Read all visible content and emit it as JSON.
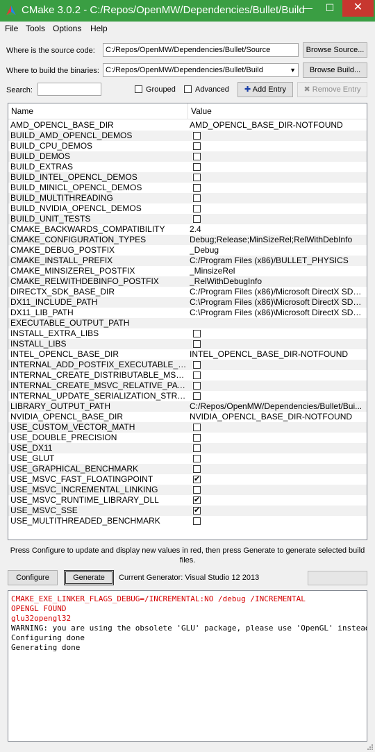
{
  "window": {
    "title": "CMake 3.0.2 - C:/Repos/OpenMW/Dependencies/Bullet/Build",
    "minimize_glyph": "—",
    "maximize_glyph": "☐",
    "close_glyph": "✕"
  },
  "menu": [
    "File",
    "Tools",
    "Options",
    "Help"
  ],
  "source": {
    "label": "Where is the source code:",
    "value": "C:/Repos/OpenMW/Dependencies/Bullet/Source",
    "button": "Browse Source..."
  },
  "build": {
    "label": "Where to build the binaries:",
    "value": "C:/Repos/OpenMW/Dependencies/Bullet/Build",
    "button": "Browse Build..."
  },
  "search": {
    "label": "Search:",
    "value": ""
  },
  "options": {
    "grouped": {
      "label": "Grouped",
      "checked": false
    },
    "advanced": {
      "label": "Advanced",
      "checked": false
    },
    "add_entry": "Add Entry",
    "remove_entry": "Remove Entry"
  },
  "table": {
    "headers": [
      "Name",
      "Value"
    ],
    "rows": [
      {
        "name": "AMD_OPENCL_BASE_DIR",
        "type": "text",
        "value": "AMD_OPENCL_BASE_DIR-NOTFOUND"
      },
      {
        "name": "BUILD_AMD_OPENCL_DEMOS",
        "type": "bool",
        "checked": false
      },
      {
        "name": "BUILD_CPU_DEMOS",
        "type": "bool",
        "checked": false
      },
      {
        "name": "BUILD_DEMOS",
        "type": "bool",
        "checked": false
      },
      {
        "name": "BUILD_EXTRAS",
        "type": "bool",
        "checked": false
      },
      {
        "name": "BUILD_INTEL_OPENCL_DEMOS",
        "type": "bool",
        "checked": false
      },
      {
        "name": "BUILD_MINICL_OPENCL_DEMOS",
        "type": "bool",
        "checked": false
      },
      {
        "name": "BUILD_MULTITHREADING",
        "type": "bool",
        "checked": false
      },
      {
        "name": "BUILD_NVIDIA_OPENCL_DEMOS",
        "type": "bool",
        "checked": false
      },
      {
        "name": "BUILD_UNIT_TESTS",
        "type": "bool",
        "checked": false
      },
      {
        "name": "CMAKE_BACKWARDS_COMPATIBILITY",
        "type": "text",
        "value": "2.4"
      },
      {
        "name": "CMAKE_CONFIGURATION_TYPES",
        "type": "text",
        "value": "Debug;Release;MinSizeRel;RelWithDebInfo"
      },
      {
        "name": "CMAKE_DEBUG_POSTFIX",
        "type": "text",
        "value": "_Debug"
      },
      {
        "name": "CMAKE_INSTALL_PREFIX",
        "type": "text",
        "value": "C:/Program Files (x86)/BULLET_PHYSICS"
      },
      {
        "name": "CMAKE_MINSIZEREL_POSTFIX",
        "type": "text",
        "value": "_MinsizeRel"
      },
      {
        "name": "CMAKE_RELWITHDEBINFO_POSTFIX",
        "type": "text",
        "value": "_RelWithDebugInfo"
      },
      {
        "name": "DIRECTX_SDK_BASE_DIR",
        "type": "text",
        "value": "C:/Program Files (x86)/Microsoft DirectX SDK ..."
      },
      {
        "name": "DX11_INCLUDE_PATH",
        "type": "text",
        "value": "C:\\Program Files (x86)\\Microsoft DirectX SDK ..."
      },
      {
        "name": "DX11_LIB_PATH",
        "type": "text",
        "value": "C:\\Program Files (x86)\\Microsoft DirectX SDK ..."
      },
      {
        "name": "EXECUTABLE_OUTPUT_PATH",
        "type": "text",
        "value": ""
      },
      {
        "name": "INSTALL_EXTRA_LIBS",
        "type": "bool",
        "checked": false
      },
      {
        "name": "INSTALL_LIBS",
        "type": "bool",
        "checked": false
      },
      {
        "name": "INTEL_OPENCL_BASE_DIR",
        "type": "text",
        "value": "INTEL_OPENCL_BASE_DIR-NOTFOUND"
      },
      {
        "name": "INTERNAL_ADD_POSTFIX_EXECUTABLE_NAMES",
        "type": "bool",
        "checked": false
      },
      {
        "name": "INTERNAL_CREATE_DISTRIBUTABLE_MSVC_P...",
        "type": "bool",
        "checked": false
      },
      {
        "name": "INTERNAL_CREATE_MSVC_RELATIVE_PATH_P...",
        "type": "bool",
        "checked": false
      },
      {
        "name": "INTERNAL_UPDATE_SERIALIZATION_STRUCT...",
        "type": "bool",
        "checked": false
      },
      {
        "name": "LIBRARY_OUTPUT_PATH",
        "type": "text",
        "value": "C:/Repos/OpenMW/Dependencies/Bullet/Bui..."
      },
      {
        "name": "NVIDIA_OPENCL_BASE_DIR",
        "type": "text",
        "value": "NVIDIA_OPENCL_BASE_DIR-NOTFOUND"
      },
      {
        "name": "USE_CUSTOM_VECTOR_MATH",
        "type": "bool",
        "checked": false
      },
      {
        "name": "USE_DOUBLE_PRECISION",
        "type": "bool",
        "checked": false
      },
      {
        "name": "USE_DX11",
        "type": "bool",
        "checked": false
      },
      {
        "name": "USE_GLUT",
        "type": "bool",
        "checked": false
      },
      {
        "name": "USE_GRAPHICAL_BENCHMARK",
        "type": "bool",
        "checked": false
      },
      {
        "name": "USE_MSVC_FAST_FLOATINGPOINT",
        "type": "bool",
        "checked": true
      },
      {
        "name": "USE_MSVC_INCREMENTAL_LINKING",
        "type": "bool",
        "checked": false
      },
      {
        "name": "USE_MSVC_RUNTIME_LIBRARY_DLL",
        "type": "bool",
        "checked": true
      },
      {
        "name": "USE_MSVC_SSE",
        "type": "bool",
        "checked": true
      },
      {
        "name": "USE_MULTITHREADED_BENCHMARK",
        "type": "bool",
        "checked": false
      }
    ]
  },
  "help_line1": "Press Configure to update and display new values in red, then press Generate to generate selected build",
  "help_line2": "files.",
  "actions": {
    "configure": "Configure",
    "generate": "Generate",
    "generator_label": "Current Generator: Visual Studio 12 2013"
  },
  "output": [
    {
      "text": "CMAKE_EXE_LINKER_FLAGS_DEBUG=/INCREMENTAL:NO /debug /INCREMENTAL",
      "color": "#d40000"
    },
    {
      "text": "OPENGL FOUND",
      "color": "#d40000"
    },
    {
      "text": "glu32opengl32",
      "color": "#d40000"
    },
    {
      "text": "WARNING: you are using the obsolete 'GLU' package, please use 'OpenGL' instead",
      "color": "#000000"
    },
    {
      "text": "Configuring done",
      "color": "#000000"
    },
    {
      "text": "Generating done",
      "color": "#000000"
    }
  ],
  "colors": {
    "titlebar": "#3a9e43",
    "close_button": "#c7372f",
    "output_error": "#d40000",
    "add_icon": "#1a3fa8"
  }
}
